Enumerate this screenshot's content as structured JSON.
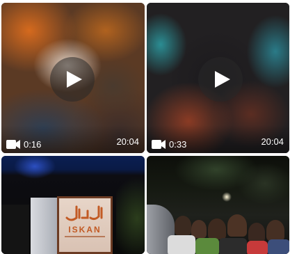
{
  "gallery": {
    "items": [
      {
        "kind": "video",
        "duration": "0:16",
        "time": "20:04",
        "icon": "video-camera-icon"
      },
      {
        "kind": "video",
        "duration": "0:33",
        "time": "20:04",
        "icon": "video-camera-icon"
      },
      {
        "kind": "photo",
        "sign_text": "ISKAN"
      },
      {
        "kind": "photo"
      }
    ]
  },
  "colors": {
    "overlay_text": "#ffffff",
    "play_button_bg": "#282828",
    "sign_text": "#c25a24"
  }
}
